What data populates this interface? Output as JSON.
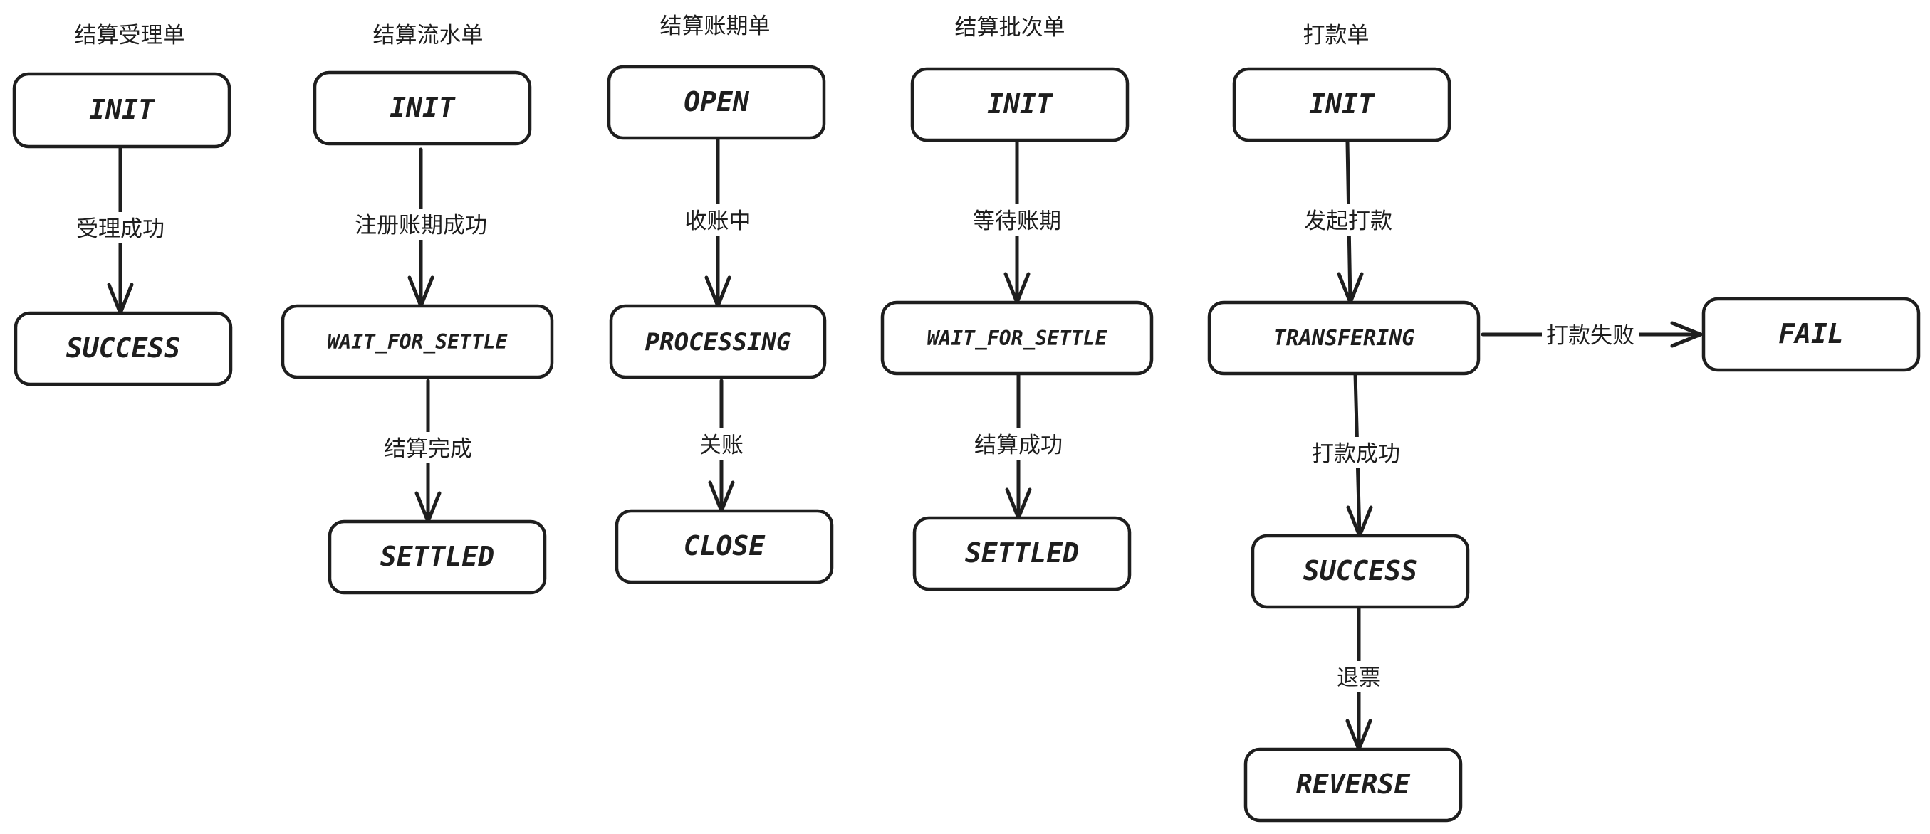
{
  "columns": [
    {
      "title": "结算受理单",
      "states": [
        {
          "id": "c1-init",
          "label": "INIT"
        },
        {
          "id": "c1-success",
          "label": "SUCCESS"
        }
      ],
      "transitions": [
        {
          "from": "c1-init",
          "to": "c1-success",
          "label": "受理成功"
        }
      ]
    },
    {
      "title": "结算流水单",
      "states": [
        {
          "id": "c2-init",
          "label": "INIT"
        },
        {
          "id": "c2-wait",
          "label": "WAIT_FOR_SETTLE"
        },
        {
          "id": "c2-settled",
          "label": "SETTLED"
        }
      ],
      "transitions": [
        {
          "from": "c2-init",
          "to": "c2-wait",
          "label": "注册账期成功"
        },
        {
          "from": "c2-wait",
          "to": "c2-settled",
          "label": "结算完成"
        }
      ]
    },
    {
      "title": "结算账期单",
      "states": [
        {
          "id": "c3-open",
          "label": "OPEN"
        },
        {
          "id": "c3-processing",
          "label": "PROCESSING"
        },
        {
          "id": "c3-close",
          "label": "CLOSE"
        }
      ],
      "transitions": [
        {
          "from": "c3-open",
          "to": "c3-processing",
          "label": "收账中"
        },
        {
          "from": "c3-processing",
          "to": "c3-close",
          "label": "关账"
        }
      ]
    },
    {
      "title": "结算批次单",
      "states": [
        {
          "id": "c4-init",
          "label": "INIT"
        },
        {
          "id": "c4-wait",
          "label": "WAIT_FOR_SETTLE"
        },
        {
          "id": "c4-settled",
          "label": "SETTLED"
        }
      ],
      "transitions": [
        {
          "from": "c4-init",
          "to": "c4-wait",
          "label": "等待账期"
        },
        {
          "from": "c4-wait",
          "to": "c4-settled",
          "label": "结算成功"
        }
      ]
    },
    {
      "title": "打款单",
      "states": [
        {
          "id": "c5-init",
          "label": "INIT"
        },
        {
          "id": "c5-transfering",
          "label": "TRANSFERING"
        },
        {
          "id": "c5-fail",
          "label": "FAIL"
        },
        {
          "id": "c5-success",
          "label": "SUCCESS"
        },
        {
          "id": "c5-reverse",
          "label": "REVERSE"
        }
      ],
      "transitions": [
        {
          "from": "c5-init",
          "to": "c5-transfering",
          "label": "发起打款"
        },
        {
          "from": "c5-transfering",
          "to": "c5-fail",
          "label": "打款失败"
        },
        {
          "from": "c5-transfering",
          "to": "c5-success",
          "label": "打款成功"
        },
        {
          "from": "c5-success",
          "to": "c5-reverse",
          "label": "退票"
        }
      ]
    }
  ]
}
